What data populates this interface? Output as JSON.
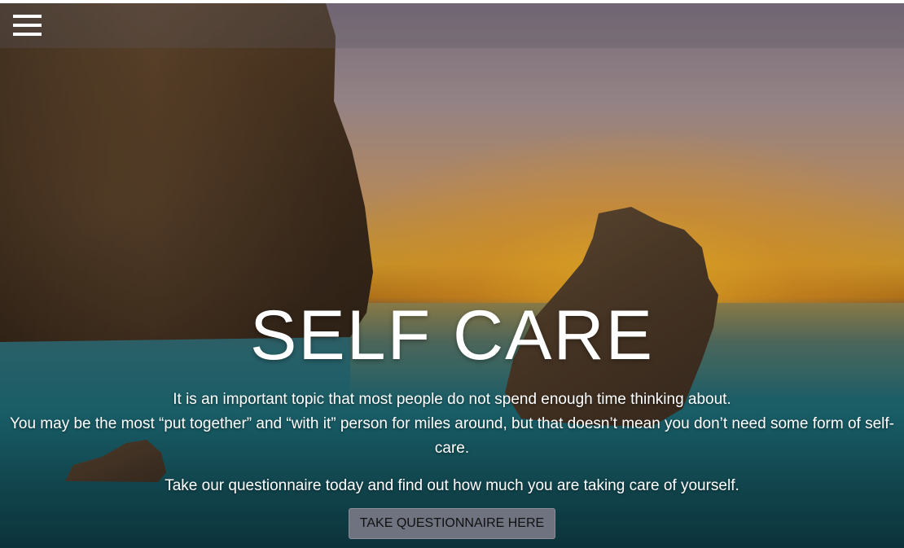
{
  "header": {
    "menu_icon": "hamburger-menu-icon"
  },
  "hero": {
    "title": "SELF CARE",
    "description_line1": "It is an important topic that most people do not spend enough time thinking about.",
    "description_line2": "You may be the most “put together” and “with it” person for miles around, but that doesn’t mean you don’t need some form of self-care.",
    "cta_text": "Take our questionnaire today and find out how much you are taking care of yourself.",
    "cta_button_label": "TAKE QUESTIONNAIRE HERE"
  },
  "colors": {
    "button_bg": "#6f7380",
    "text": "#ffffff"
  }
}
